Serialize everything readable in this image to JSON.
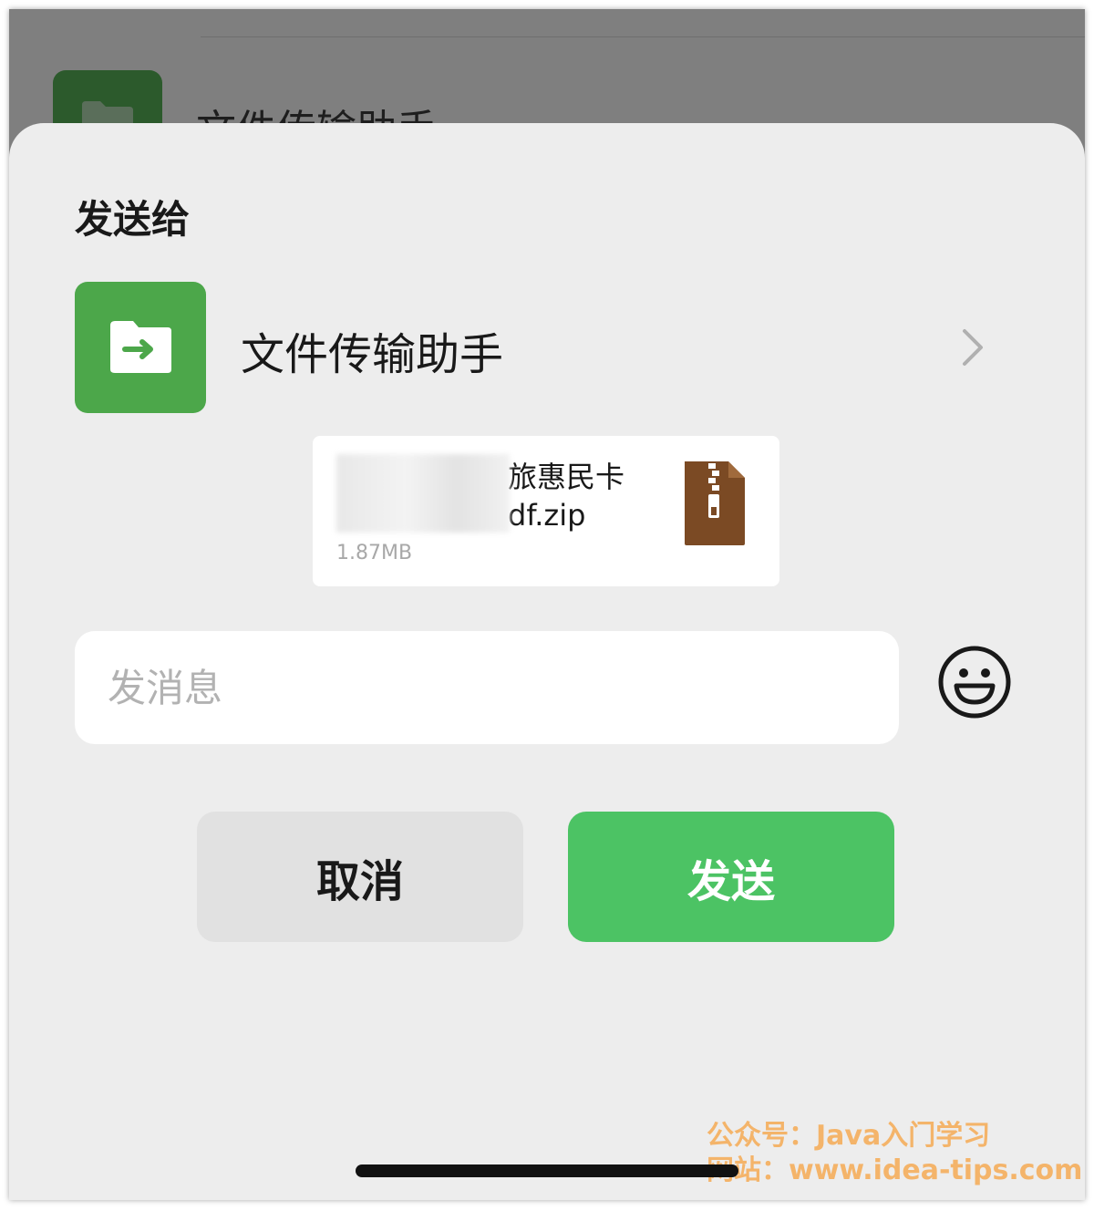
{
  "background": {
    "chat_title": "文件传输助手"
  },
  "sheet": {
    "title": "发送给",
    "recipient": {
      "name": "文件传输助手",
      "avatar_icon": "folder-arrow-icon",
      "avatar_color": "#4ca74a"
    },
    "file": {
      "name_visible": "旅惠民卡\ndf.zip",
      "size": "1.87MB",
      "icon": "zip-file-icon",
      "icon_color": "#7b4a24"
    },
    "message": {
      "placeholder": "发消息",
      "value": ""
    },
    "emoji_icon": "smiley-face-icon",
    "cancel_label": "取消",
    "send_label": "发送",
    "send_color": "#4cc364"
  },
  "watermark": {
    "line1": "公众号：Java入门学习",
    "line2": "网站：www.idea-tips.com"
  }
}
